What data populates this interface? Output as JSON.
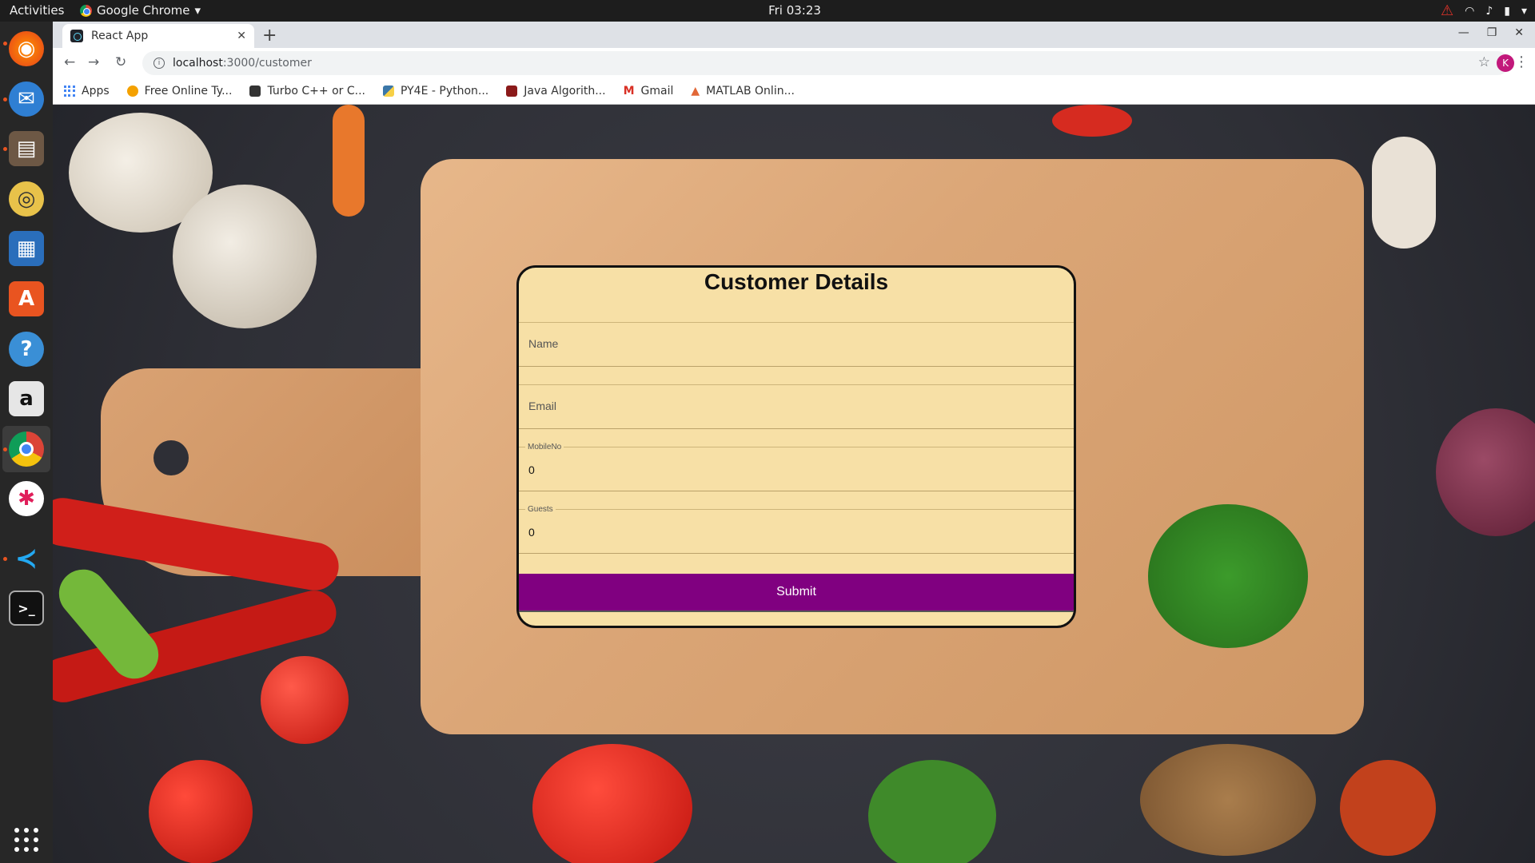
{
  "topbar": {
    "activities": "Activities",
    "app_name": "Google Chrome",
    "clock": "Fri 03:23"
  },
  "chrome": {
    "tab_title": "React App",
    "url_host": "localhost",
    "url_path": ":3000/customer",
    "profile_initial": "K",
    "bookmarks": [
      {
        "label": "Apps",
        "color": "#4285f4"
      },
      {
        "label": "Free Online Ty...",
        "color": "#f4a100"
      },
      {
        "label": "Turbo C++ or C...",
        "color": "#333333"
      },
      {
        "label": "PY4E - Python...",
        "color": "#3b77a8"
      },
      {
        "label": "Java Algorith...",
        "color": "#8b1a1a"
      },
      {
        "label": "Gmail",
        "color": "#d93025"
      },
      {
        "label": "MATLAB Onlin...",
        "color": "#e16737"
      }
    ]
  },
  "form": {
    "title": "Customer Details",
    "name_placeholder": "Name",
    "email_placeholder": "Email",
    "mobile_label": "MobileNo",
    "mobile_value": "0",
    "guests_label": "Guests",
    "guests_value": "0",
    "submit_label": "Submit",
    "button_color": "#800080",
    "card_color": "#f7e0a6"
  }
}
